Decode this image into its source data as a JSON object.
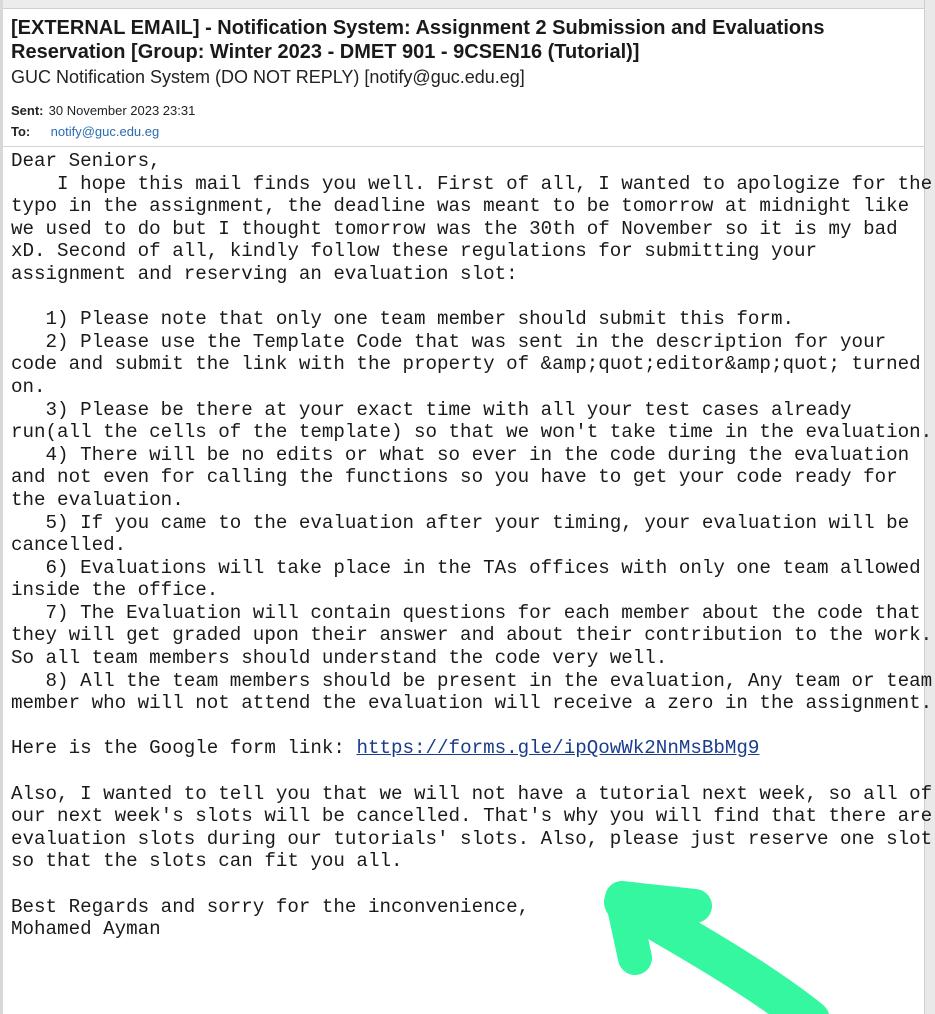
{
  "email": {
    "subject_line1": "[EXTERNAL EMAIL] - Notification System: Assignment 2 Submission and Evaluations",
    "subject_line2": "Reservation [Group: Winter 2023 - DMET 901 - 9CSEN16 (Tutorial)]",
    "sender": "GUC Notification System (DO NOT REPLY) [notify@guc.edu.eg]",
    "sent_label": "Sent:",
    "sent_value": "30 November 2023 23:31",
    "to_label": "To:",
    "to_value": "notify@guc.edu.eg"
  },
  "body": {
    "greeting": "Dear Seniors,",
    "intro": [
      "    I hope this mail finds you well. First of all, I wanted to apologize for the",
      "typo in the assignment, the deadline was meant to be tomorrow at midnight like",
      "we used to do but I thought tomorrow was the 30th of November so it is my bad",
      "xD. Second of all, kindly follow these regulations for submitting your",
      "assignment and reserving an evaluation slot:"
    ],
    "rules": [
      "   1) Please note that only one team member should submit this form.",
      "   2) Please use the Template Code that was sent in the description for your",
      "code and submit the link with the property of &amp;quot;editor&amp;quot; turned",
      "on.",
      "   3) Please be there at your exact time with all your test cases already",
      "run(all the cells of the template) so that we won't take time in the evaluation.",
      "   4) There will be no edits or what so ever in the code during the evaluation",
      "and not even for calling the functions so you have to get your code ready for",
      "the evaluation.",
      "   5) If you came to the evaluation after your timing, your evaluation will be",
      "cancelled.",
      "   6) Evaluations will take place in the TAs offices with only one team allowed",
      "inside the office.",
      "   7) The Evaluation will contain questions for each member about the code that",
      "they will get graded upon their answer and about their contribution to the work.",
      "So all team members should understand the code very well.",
      "   8) All the team members should be present in the evaluation, Any team or team",
      "member who will not attend the evaluation will receive a zero in the assignment."
    ],
    "form_prefix": "Here is the Google form link: ",
    "form_link": "https://forms.gle/ipQowWk2NnMsBbMg9",
    "also": [
      "Also, I wanted to tell you that we will not have a tutorial next week, so all of",
      "our next week's slots will be cancelled. That's why you will find that there are",
      "evaluation slots during our tutorials' slots. Also, please just reserve one slot",
      "so that the slots can fit you all."
    ],
    "closing": "Best Regards and sorry for the inconvenience,",
    "signature": "Mohamed Ayman"
  },
  "annotation": {
    "color": "#35f7a0",
    "icon": "arrow-annotation-icon"
  }
}
